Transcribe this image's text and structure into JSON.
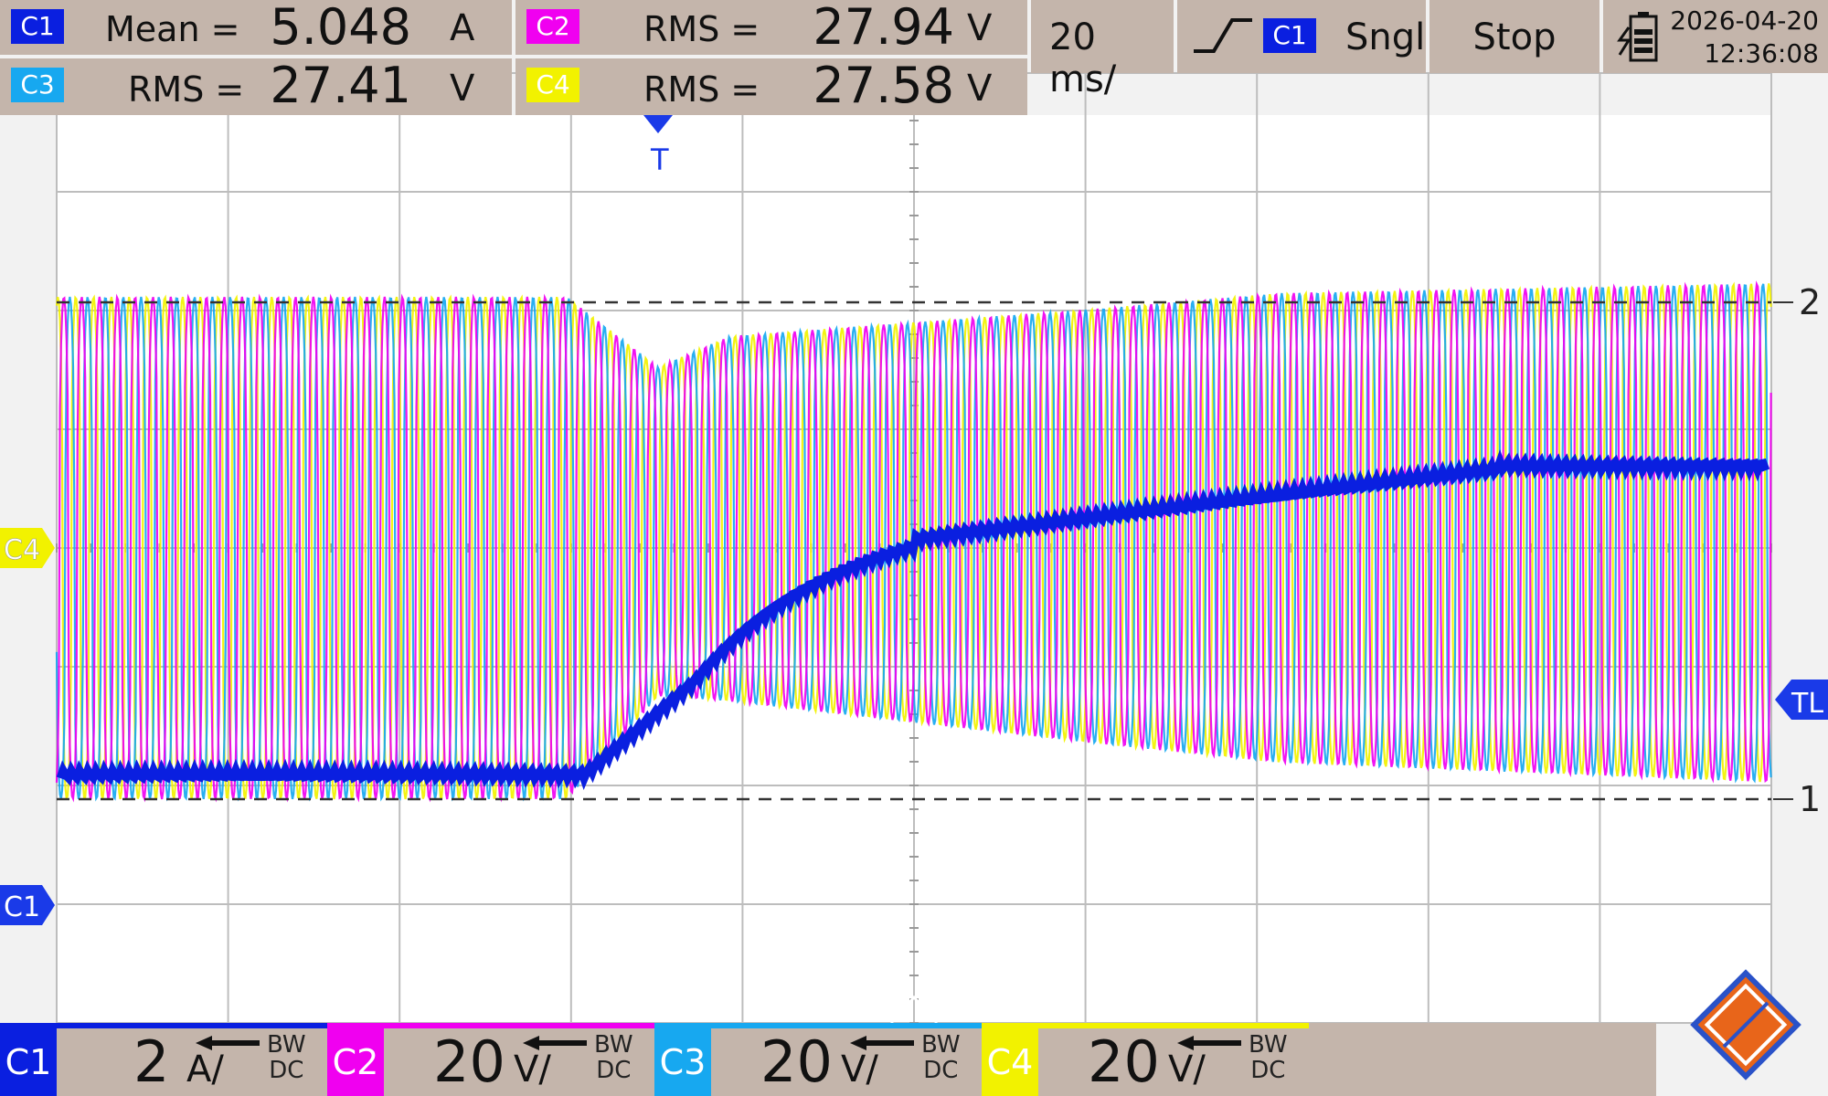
{
  "measurements": [
    {
      "channel": "C1",
      "label": "Mean =",
      "value": "5.048",
      "unit": "A"
    },
    {
      "channel": "C2",
      "label": "RMS =",
      "value": "27.94",
      "unit": "V"
    },
    {
      "channel": "C3",
      "label": "RMS =",
      "value": "27.41",
      "unit": "V"
    },
    {
      "channel": "C4",
      "label": "RMS =",
      "value": "27.58",
      "unit": "V"
    }
  ],
  "timebase": "20 ms/",
  "trigger": {
    "source": "C1",
    "mode": "Sngl",
    "marker": "T",
    "level_marker": "TL"
  },
  "run_state": "Stop",
  "datetime": {
    "date": "2026-04-20",
    "time": "12:36:08"
  },
  "cursor_labels": {
    "upper": "2",
    "lower": "1"
  },
  "channel_offsets": {
    "c4": "C4",
    "c1": "C1"
  },
  "channels": [
    {
      "label": "C1",
      "scale": "2",
      "unit": "A/",
      "bw": "BW",
      "coupling": "DC"
    },
    {
      "label": "C2",
      "scale": "20",
      "unit": "V/",
      "bw": "BW",
      "coupling": "DC"
    },
    {
      "label": "C3",
      "scale": "20",
      "unit": "V/",
      "bw": "BW",
      "coupling": "DC"
    },
    {
      "label": "C4",
      "scale": "20",
      "unit": "V/",
      "bw": "BW",
      "coupling": "DC"
    }
  ],
  "colors": {
    "c1": "#0a1fe0",
    "c2": "#f000f0",
    "c3": "#17a8f0",
    "c4": "#f2f200",
    "panel": "#c4b5ab",
    "accent": "#e8651a"
  },
  "icons": [
    "trigger-edge-rising-icon",
    "battery-icon",
    "rohde-schwarz-logo-icon"
  ]
}
